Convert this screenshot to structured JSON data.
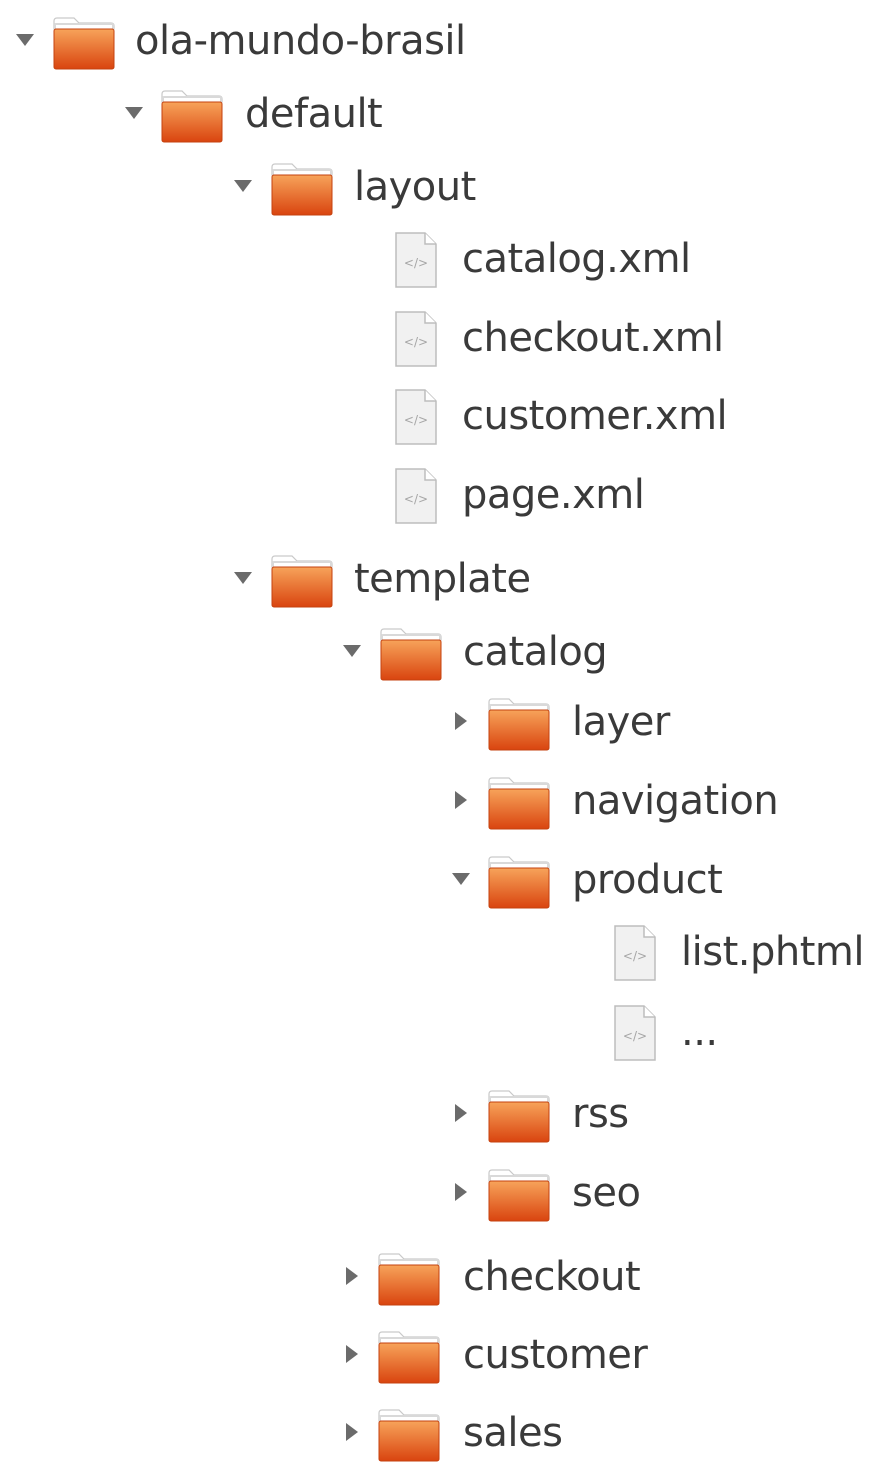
{
  "tree": {
    "nodes": [
      {
        "label": "ola-mundo-brasil",
        "type": "folder",
        "state": "expanded"
      },
      {
        "label": "default",
        "type": "folder",
        "state": "expanded"
      },
      {
        "label": "layout",
        "type": "folder",
        "state": "expanded"
      },
      {
        "label": "catalog.xml",
        "type": "file"
      },
      {
        "label": "checkout.xml",
        "type": "file"
      },
      {
        "label": "customer.xml",
        "type": "file"
      },
      {
        "label": "page.xml",
        "type": "file"
      },
      {
        "label": "template",
        "type": "folder",
        "state": "expanded"
      },
      {
        "label": "catalog",
        "type": "folder",
        "state": "expanded"
      },
      {
        "label": "layer",
        "type": "folder",
        "state": "collapsed"
      },
      {
        "label": "navigation",
        "type": "folder",
        "state": "collapsed"
      },
      {
        "label": "product",
        "type": "folder",
        "state": "expanded"
      },
      {
        "label": "list.phtml",
        "type": "file"
      },
      {
        "label": "...",
        "type": "file"
      },
      {
        "label": "rss",
        "type": "folder",
        "state": "collapsed"
      },
      {
        "label": "seo",
        "type": "folder",
        "state": "collapsed"
      },
      {
        "label": "checkout",
        "type": "folder",
        "state": "collapsed"
      },
      {
        "label": "customer",
        "type": "folder",
        "state": "collapsed"
      },
      {
        "label": "sales",
        "type": "folder",
        "state": "collapsed"
      }
    ]
  },
  "colors": {
    "folder_light": "#f7a35a",
    "folder_dark": "#d9440f",
    "arrow": "#6b6b6b",
    "text": "#3a3a3a"
  }
}
